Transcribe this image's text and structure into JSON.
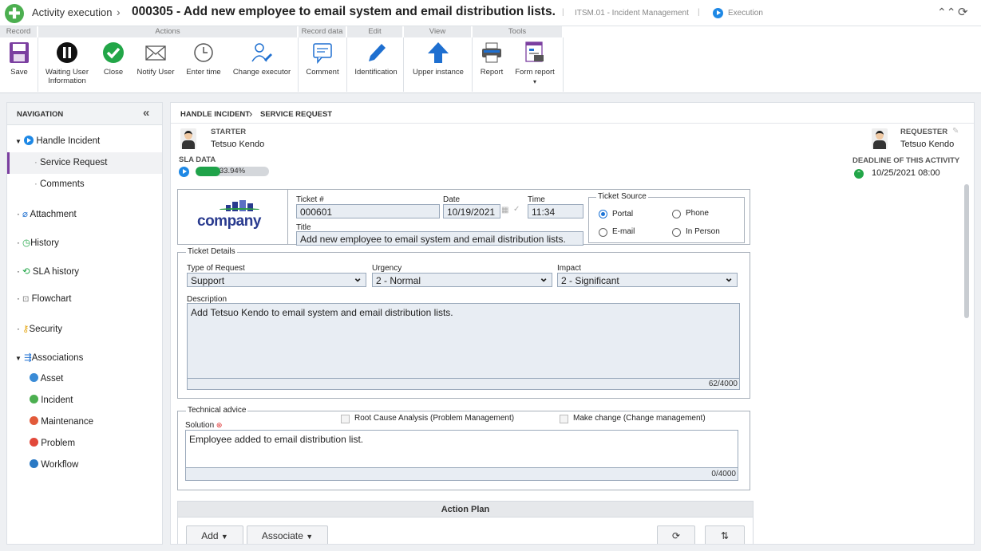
{
  "title": {
    "app": "Activity execution",
    "separator": "›",
    "record": "000305 - Add new employee to email system and email distribution lists.",
    "process": "ITSM.01 - Incident Management",
    "status": "Execution",
    "divider": "|"
  },
  "toolbar": {
    "groups": [
      "Record",
      "Actions",
      "Record data",
      "Edit",
      "View",
      "Tools"
    ],
    "buttons": {
      "save": "Save",
      "waiting": "Waiting User Information",
      "close": "Close",
      "notify": "Notify User",
      "enter_time": "Enter time",
      "change_executor": "Change executor",
      "comment": "Comment",
      "identification": "Identification",
      "upper_instance": "Upper instance",
      "report": "Report",
      "form_report": "Form report"
    }
  },
  "nav": {
    "title": "NAVIGATION",
    "collapse_glyph": "«",
    "items": [
      {
        "label": "Handle Incident"
      },
      {
        "label": "Service Request"
      },
      {
        "label": "Comments"
      },
      {
        "label": "Attachment"
      },
      {
        "label": "History"
      },
      {
        "label": "SLA history"
      },
      {
        "label": "Flowchart"
      },
      {
        "label": "Security"
      },
      {
        "label": "Associations"
      },
      {
        "label": "Asset"
      },
      {
        "label": "Incident"
      },
      {
        "label": "Maintenance"
      },
      {
        "label": "Problem"
      },
      {
        "label": "Workflow"
      }
    ]
  },
  "breadcrumb": {
    "first": "HANDLE INCIDENT",
    "sep": "›",
    "second": "SERVICE REQUEST"
  },
  "starter": {
    "label": "STARTER",
    "name": "Tetsuo Kendo"
  },
  "requester": {
    "label": "REQUESTER",
    "name": "Tetsuo Kendo"
  },
  "sla": {
    "label": "SLA DATA",
    "percent_text": "33.94%",
    "progress": 33.94
  },
  "deadline": {
    "label": "DEADLINE OF THIS ACTIVITY",
    "value": "10/25/2021 08:00"
  },
  "form": {
    "logo_text": "company",
    "ticket_no": {
      "label": "Ticket #",
      "value": "000601"
    },
    "date": {
      "label": "Date",
      "value": "10/19/2021"
    },
    "time": {
      "label": "Time",
      "value": "11:34"
    },
    "title": {
      "label": "Title",
      "value": "Add new employee to email system and email distribution lists."
    },
    "source": {
      "legend": "Ticket Source",
      "options": [
        "Portal",
        "Phone",
        "E-mail",
        "In Person"
      ],
      "selected": "Portal"
    },
    "details": {
      "legend": "Ticket Details",
      "type": {
        "label": "Type of Request",
        "value": "Support"
      },
      "urgency": {
        "label": "Urgency",
        "value": "2 - Normal"
      },
      "impact": {
        "label": "Impact",
        "value": "2 - Significant"
      },
      "description": {
        "label": "Description",
        "value": "Add Tetsuo Kendo to email system and email distribution lists.",
        "counter": "62/4000"
      }
    },
    "technical": {
      "legend": "Technical advice",
      "rca": "Root Cause Analysis (Problem Management)",
      "change": "Make change (Change management)",
      "solution": {
        "label": "Solution",
        "value": "Employee added to email distribution list.",
        "counter": "0/4000"
      }
    },
    "action_plan": {
      "title": "Action Plan",
      "add": "Add",
      "associate": "Associate"
    }
  }
}
